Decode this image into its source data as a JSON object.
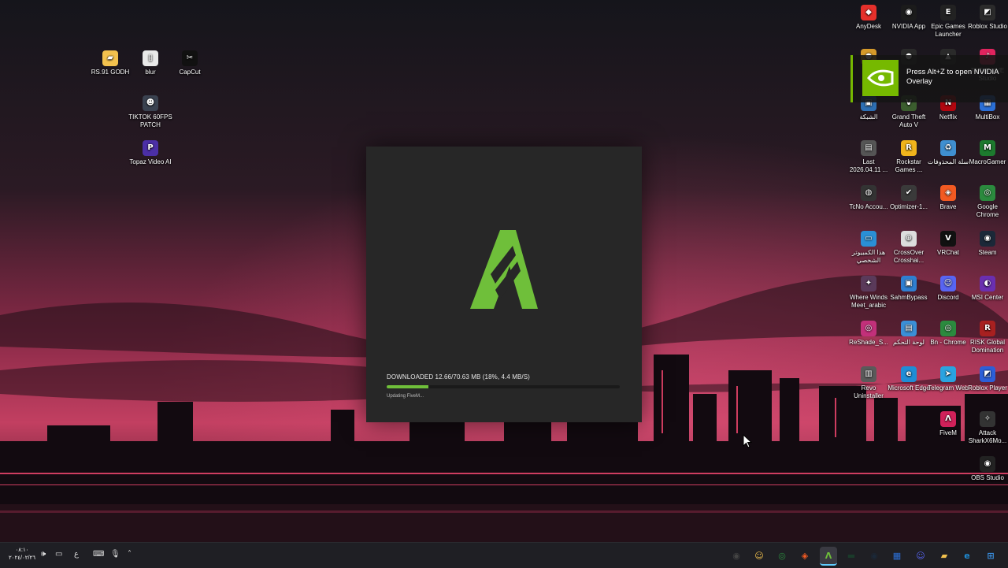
{
  "desktop_left": [
    {
      "label": "RS.91 GODH",
      "icon": "folder-icon",
      "color": "#f2c14e",
      "glyph": "▰"
    },
    {
      "label": "blur",
      "icon": "file-icon",
      "color": "#e9e9e9",
      "glyph": "▯"
    },
    {
      "label": "CapCut",
      "icon": "capcut-icon",
      "color": "#111111",
      "glyph": "✂"
    },
    {
      "label": "TIKTOK 60FPS PATCH",
      "icon": "avatar-icon",
      "color": "#3a4250",
      "glyph": "☻"
    },
    {
      "label": "Topaz Video AI",
      "icon": "topaz-icon",
      "color": "#4b2fa6",
      "glyph": "P"
    }
  ],
  "desktop_right": [
    {
      "label": "AnyDesk",
      "icon": "anydesk-icon",
      "color": "#e5302b",
      "glyph": "◆"
    },
    {
      "label": "NVIDIA App",
      "icon": "nvidia-icon",
      "color": "#1b1b1b",
      "glyph": "◉"
    },
    {
      "label": "Epic Games Launcher",
      "icon": "epic-icon",
      "color": "#222222",
      "glyph": "E"
    },
    {
      "label": "Roblox Studio",
      "icon": "roblox-studio-icon",
      "color": "#2b2b2b",
      "glyph": "◩"
    },
    {
      "label": "",
      "icon": "app-icon",
      "color": "#d59a2a",
      "glyph": "●"
    },
    {
      "label": "",
      "icon": "app-icon",
      "color": "#2a2a2a",
      "glyph": "●"
    },
    {
      "label": "",
      "icon": "app-icon",
      "color": "#2a2a2a",
      "glyph": "▲"
    },
    {
      "label": "TikTok LIVE Studio",
      "icon": "tiktok-icon",
      "color": "#e0245e",
      "glyph": "♪"
    },
    {
      "label": "الشبكة",
      "icon": "network-icon",
      "color": "#2d6fb3",
      "glyph": "▣"
    },
    {
      "label": "Grand Theft Auto V",
      "icon": "gta-icon",
      "color": "#3b5d2e",
      "glyph": "V"
    },
    {
      "label": "Netflix",
      "icon": "netflix-icon",
      "color": "#b0060f",
      "glyph": "N"
    },
    {
      "label": "MultiBox",
      "icon": "multibox-icon",
      "color": "#2b6fd6",
      "glyph": "▦"
    },
    {
      "label": "Last 2026.04.11 ...",
      "icon": "file-icon",
      "color": "#555555",
      "glyph": "▤"
    },
    {
      "label": "Rockstar Games ...",
      "icon": "rockstar-icon",
      "color": "#f0b41c",
      "glyph": "R"
    },
    {
      "label": "سلة المحذوفات",
      "icon": "recycle-bin-icon",
      "color": "#3f8fd0",
      "glyph": "♻"
    },
    {
      "label": "MacroGamer",
      "icon": "macrogamer-icon",
      "color": "#1d7a2e",
      "glyph": "M"
    },
    {
      "label": "TcNo Accou...",
      "icon": "tcno-icon",
      "color": "#333333",
      "glyph": "◍"
    },
    {
      "label": "Optimizer-1...",
      "icon": "check-icon",
      "color": "#3a3a3a",
      "glyph": "✔"
    },
    {
      "label": "Brave",
      "icon": "brave-icon",
      "color": "#f25a22",
      "glyph": "◈"
    },
    {
      "label": "Google Chrome",
      "icon": "chrome-icon",
      "color": "#2b8a3e",
      "glyph": "◎"
    },
    {
      "label": "هذا الكمبيوتر الشخصي",
      "icon": "computer-icon",
      "color": "#2a8fd6",
      "glyph": "▭"
    },
    {
      "label": "CrossOver Crosshai...",
      "icon": "crosshair-icon",
      "color": "#dddddd",
      "glyph": "⊕"
    },
    {
      "label": "VRChat",
      "icon": "vrchat-icon",
      "color": "#111111",
      "glyph": "V"
    },
    {
      "label": "Steam",
      "icon": "steam-icon",
      "color": "#1b2838",
      "glyph": "◉"
    },
    {
      "label": "Where Winds Meet_arabic",
      "icon": "game-icon",
      "color": "#5a3a5a",
      "glyph": "✦"
    },
    {
      "label": "SahmBypass",
      "icon": "app-icon",
      "color": "#2f7fd1",
      "glyph": "▣"
    },
    {
      "label": "Discord",
      "icon": "discord-icon",
      "color": "#5865f2",
      "glyph": "☺"
    },
    {
      "label": "MSI Center",
      "icon": "msi-icon",
      "color": "#6a2fb0",
      "glyph": "◐"
    },
    {
      "label": "ReShade_S...",
      "icon": "reshade-icon",
      "color": "#c2307a",
      "glyph": "◎"
    },
    {
      "label": "لوحة التحكم",
      "icon": "control-panel-icon",
      "color": "#3b8fd6",
      "glyph": "▤"
    },
    {
      "label": "Bn - Chrome",
      "icon": "chrome-icon",
      "color": "#2b8a3e",
      "glyph": "◎"
    },
    {
      "label": "RISK Global Domination",
      "icon": "risk-icon",
      "color": "#a82020",
      "glyph": "R"
    },
    {
      "label": "Revo Uninstaller",
      "icon": "revo-icon",
      "color": "#5a5a5a",
      "glyph": "▥"
    },
    {
      "label": "Microsoft Edge",
      "icon": "edge-icon",
      "color": "#1f8dd6",
      "glyph": "e"
    },
    {
      "label": "Telegram Web",
      "icon": "telegram-icon",
      "color": "#2aa3e0",
      "glyph": "➤"
    },
    {
      "label": "Roblox Player",
      "icon": "roblox-icon",
      "color": "#2c5fd8",
      "glyph": "◩"
    },
    {
      "label": "",
      "icon": "blank",
      "color": "transparent",
      "glyph": ""
    },
    {
      "label": "",
      "icon": "blank",
      "color": "transparent",
      "glyph": ""
    },
    {
      "label": "FiveM",
      "icon": "fivem-icon",
      "color": "#d0215a",
      "glyph": "Λ"
    },
    {
      "label": "Attack SharkX6Mo...",
      "icon": "attack-shark-icon",
      "color": "#333333",
      "glyph": "✧"
    },
    {
      "label": "",
      "icon": "blank",
      "color": "transparent",
      "glyph": ""
    },
    {
      "label": "",
      "icon": "blank",
      "color": "transparent",
      "glyph": ""
    },
    {
      "label": "",
      "icon": "blank",
      "color": "transparent",
      "glyph": ""
    },
    {
      "label": "OBS Studio",
      "icon": "obs-icon",
      "color": "#222222",
      "glyph": "◉"
    }
  ],
  "overlay": {
    "message": "Press Alt+Z to open NVIDIA Overlay",
    "accent": "#76b900"
  },
  "launcher": {
    "status": "DOWNLOADED 12.66/70.63 MB (18%, 4.4 MB/S)",
    "progress": 0.18,
    "substatus": "Updating FiveM...",
    "accent": "#6fbf3a"
  },
  "taskbar": {
    "clock_time": "٠٨:١٠",
    "clock_date": "٢٠٢٤/٠٢/٢٦",
    "tray": [
      {
        "icon": "volume-icon",
        "glyph": "🕪"
      },
      {
        "icon": "display-icon",
        "glyph": "▭"
      },
      {
        "icon": "language-icon",
        "glyph": "ع"
      },
      {
        "icon": "keyboard-icon",
        "glyph": "⌨"
      },
      {
        "icon": "microphone-icon",
        "glyph": "🎙"
      },
      {
        "icon": "chevron-up-icon",
        "glyph": "˄"
      }
    ],
    "apps": [
      {
        "icon": "obs-icon",
        "glyph": "◉",
        "color": "#444444"
      },
      {
        "icon": "emoji-icon",
        "glyph": "☺",
        "color": "#f2c14e"
      },
      {
        "icon": "chrome-icon",
        "glyph": "◎",
        "color": "#2b8a3e"
      },
      {
        "icon": "brave-icon",
        "glyph": "◈",
        "color": "#f25a22"
      },
      {
        "icon": "fivem-icon",
        "glyph": "Λ",
        "color": "#2a2a2a",
        "active": true
      },
      {
        "icon": "nvidia-icon",
        "glyph": "▬",
        "color": "#1a3b2a"
      },
      {
        "icon": "steam-icon",
        "glyph": "◉",
        "color": "#1b2838"
      },
      {
        "icon": "store-icon",
        "glyph": "▦",
        "color": "#2b6fd6"
      },
      {
        "icon": "discord-icon",
        "glyph": "☺",
        "color": "#5865f2"
      },
      {
        "icon": "folder-icon",
        "glyph": "▰",
        "color": "#f2c14e"
      },
      {
        "icon": "edge-icon",
        "glyph": "e",
        "color": "#1f8dd6"
      },
      {
        "icon": "windows-icon",
        "glyph": "⊞",
        "color": "#3a8fe0"
      }
    ]
  }
}
